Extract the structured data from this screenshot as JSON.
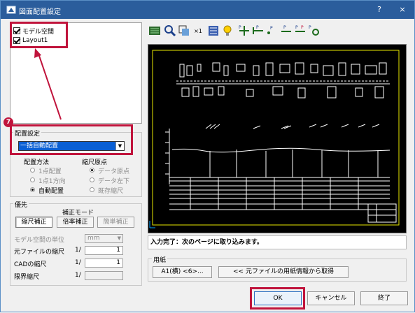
{
  "window": {
    "title": "図面配置設定",
    "help_glyph": "?",
    "close_glyph": "×"
  },
  "tree": {
    "items": [
      {
        "label": "モデル空間",
        "checked": true
      },
      {
        "label": "Layout1",
        "checked": true
      }
    ]
  },
  "annotation": {
    "step_number": "7"
  },
  "placement": {
    "group_label": "配置設定",
    "mode_value": "一括自動配置",
    "method_label": "配置方法",
    "method_options": [
      "1点配置",
      "1点1方向",
      "自動配置"
    ],
    "method_selected": "自動配置",
    "origin_label": "縮尺原点",
    "origin_options": [
      "データ原点",
      "データ左下",
      "既存縮尺"
    ],
    "origin_selected": "データ原点"
  },
  "priority": {
    "group_label": "優先",
    "correction_mode_label": "補正モード",
    "buttons": [
      "縮尺補正",
      "倍率補正",
      "簡単補正"
    ],
    "model_unit_label": "モデル空間の単位",
    "model_unit_value": "mm",
    "source_scale_label": "元ファイルの縮尺",
    "source_scale_prefix": "1/",
    "source_scale_value": "1",
    "cad_scale_label": "CADの縮尺",
    "cad_scale_prefix": "1/",
    "cad_scale_value": "1",
    "limit_scale_label": "限界縮尺",
    "limit_scale_prefix": "1/",
    "limit_scale_value": ""
  },
  "toolbar": {
    "icons": [
      "drawing-icon",
      "zoom-icon",
      "fit-icon",
      "scale-x1-icon",
      "layer-icon",
      "bulb-icon",
      "point-add-icon",
      "point-left-icon",
      "point-dot-icon",
      "point-line-icon",
      "point-multi-icon",
      "point-circle-icon"
    ],
    "x1_glyph": "×1"
  },
  "status": {
    "message": "入力完了：次のページに取り込みます。"
  },
  "paper": {
    "group_label": "用紙",
    "size_button": "A1(横) <6>...",
    "fetch_button": "<< 元ファイルの用紙情報から取得"
  },
  "footer": {
    "ok_label": "OK",
    "cancel_label": "キャンセル",
    "exit_label": "終了"
  },
  "colors": {
    "title_bg": "#2b5d9c",
    "highlight": "#c0143c",
    "selection": "#0a5fd4",
    "preview_bg": "#000000",
    "preview_frame": "#e8e800"
  }
}
